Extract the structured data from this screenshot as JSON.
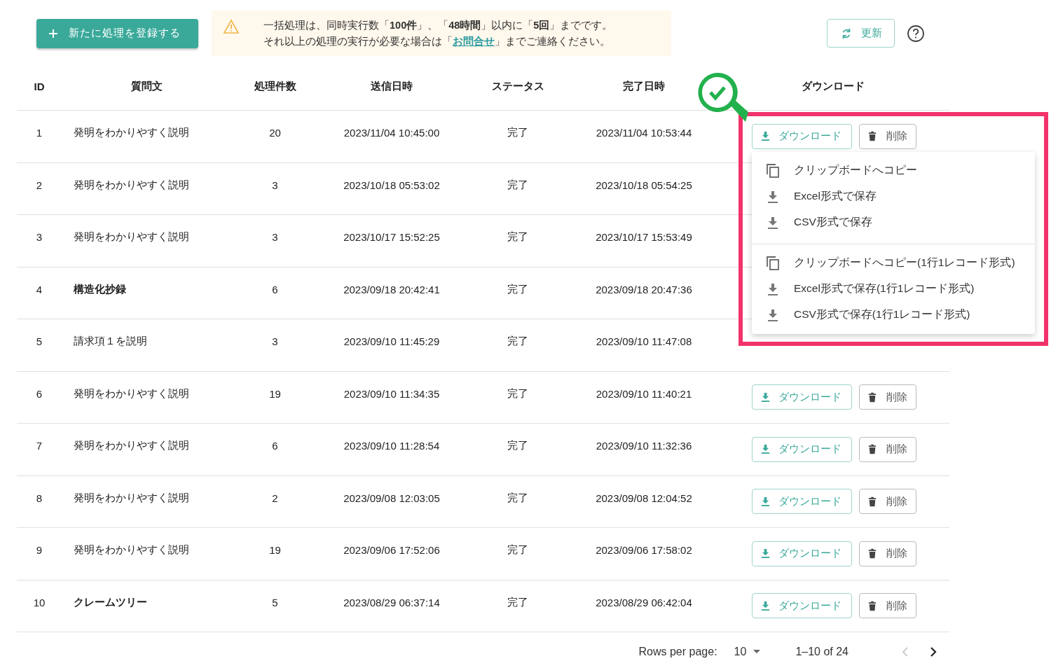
{
  "new_button": {
    "label": "新たに処理を登録する"
  },
  "notice": {
    "line1": "一括処理は、同時実行数「**100件**」、「**48時間**」以内に「**5回**」までです。",
    "line2_before": "それ以上の処理の実行が必要な場合は「",
    "line2_link": "お問合せ",
    "line2_after": "」までご連絡ください。"
  },
  "refresh_button": {
    "label": "更新"
  },
  "table": {
    "columns": [
      "ID",
      "質問文",
      "処理件数",
      "送信日時",
      "ステータス",
      "完了日時",
      "ダウンロード"
    ],
    "rows": [
      {
        "id": "1",
        "question": "発明をわかりやすく説明",
        "count": "20",
        "sent": "2023/11/04 10:45:00",
        "status": "完了",
        "done": "2023/11/04 10:53:44",
        "emphasized": false,
        "download": "ダウンロード",
        "delete": "削除"
      },
      {
        "id": "2",
        "question": "発明をわかりやすく説明",
        "count": "3",
        "sent": "2023/10/18 05:53:02",
        "status": "完了",
        "done": "2023/10/18 05:54:25",
        "emphasized": false
      },
      {
        "id": "3",
        "question": "発明をわかりやすく説明",
        "count": "3",
        "sent": "2023/10/17 15:52:25",
        "status": "完了",
        "done": "2023/10/17 15:53:49",
        "emphasized": false
      },
      {
        "id": "4",
        "question": "構造化抄録",
        "count": "6",
        "sent": "2023/09/18 20:42:41",
        "status": "完了",
        "done": "2023/09/18 20:47:36",
        "emphasized": true
      },
      {
        "id": "5",
        "question": "請求項１を説明",
        "count": "3",
        "sent": "2023/09/10 11:45:29",
        "status": "完了",
        "done": "2023/09/10 11:47:08",
        "emphasized": false
      },
      {
        "id": "6",
        "question": "発明をわかりやすく説明",
        "count": "19",
        "sent": "2023/09/10 11:34:35",
        "status": "完了",
        "done": "2023/09/10 11:40:21",
        "emphasized": false,
        "download": "ダウンロード",
        "delete": "削除"
      },
      {
        "id": "7",
        "question": "発明をわかりやすく説明",
        "count": "6",
        "sent": "2023/09/10 11:28:54",
        "status": "完了",
        "done": "2023/09/10 11:32:36",
        "emphasized": false,
        "download": "ダウンロード",
        "delete": "削除"
      },
      {
        "id": "8",
        "question": "発明をわかりやすく説明",
        "count": "2",
        "sent": "2023/09/08 12:03:05",
        "status": "完了",
        "done": "2023/09/08 12:04:52",
        "emphasized": false,
        "download": "ダウンロード",
        "delete": "削除"
      },
      {
        "id": "9",
        "question": "発明をわかりやすく説明",
        "count": "19",
        "sent": "2023/09/06 17:52:06",
        "status": "完了",
        "done": "2023/09/06 17:58:02",
        "emphasized": false,
        "download": "ダウンロード",
        "delete": "削除"
      },
      {
        "id": "10",
        "question": "クレームツリー",
        "count": "5",
        "sent": "2023/08/29 06:37:14",
        "status": "完了",
        "done": "2023/08/29 06:42:04",
        "emphasized": true,
        "download": "ダウンロード",
        "delete": "削除"
      }
    ]
  },
  "menu": {
    "groups": [
      [
        {
          "kind": "copy",
          "label": "クリップボードへコピー"
        },
        {
          "kind": "download",
          "label": "Excel形式で保存"
        },
        {
          "kind": "download",
          "label": "CSV形式で保存"
        }
      ],
      [
        {
          "kind": "copy",
          "label": "クリップボードへコピー(1行1レコード形式)"
        },
        {
          "kind": "download",
          "label": "Excel形式で保存(1行1レコード形式)"
        },
        {
          "kind": "download",
          "label": "CSV形式で保存(1行1レコード形式)"
        }
      ]
    ]
  },
  "pagination": {
    "rows_label": "Rows per page:",
    "rows_value": "10",
    "range": "1–10 of 24"
  }
}
